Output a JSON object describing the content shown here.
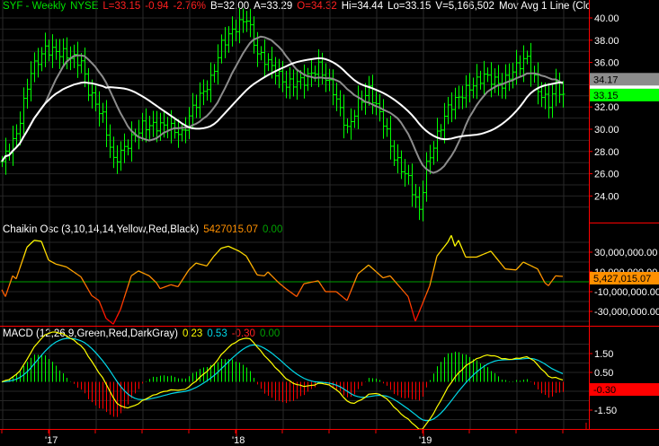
{
  "header": {
    "symbol": "SYF - Weekly",
    "exchange": "NYSE",
    "last": "L=33.15",
    "change": "-0.94",
    "change_pct": "-2.76%",
    "bid": "B=32.00",
    "ask": "A=33.29",
    "open": "O=34.32",
    "high": "Hi=34.44",
    "low": "Lo=33.15",
    "volume": "V=5,166,502",
    "study": "Mov Avg 1 Line (Close ..."
  },
  "chaikin_header": {
    "title": "Chaikin Osc (3,10,14,14,Yellow,Red,Black)",
    "value": "5427015.07",
    "zero": "0.00"
  },
  "macd_header": {
    "title": "MACD (12,26,9,Green,Red,DarkGray)",
    "macd": "0.23",
    "signal": "0.53",
    "hist": "-0.30",
    "zero": "0.00"
  },
  "colors": {
    "bars": "#00ff00",
    "fast_ma": "#8c8c8c",
    "slow_ma": "#ffffff",
    "macd": "#ffff00",
    "signal": "#00d8e8",
    "hist_pos": "#00ff00",
    "hist_neg": "#ff0000",
    "axis": "#ff0000"
  },
  "chart_data": [
    {
      "type": "line",
      "title": "SYF - Weekly price bars with moving averages",
      "x_unit": "week index",
      "xtick_labels": [
        {
          "week": 13,
          "label": "'17"
        },
        {
          "week": 65,
          "label": "'18"
        },
        {
          "week": 117,
          "label": "'19"
        }
      ],
      "ylim": [
        22,
        41
      ],
      "yticks": [
        "40.00",
        "38.00",
        "36.00",
        "34.00",
        "32.00",
        "30.00",
        "28.00",
        "26.00",
        "24.00"
      ],
      "close_keypoints": [
        [
          0,
          27.1
        ],
        [
          4,
          29.5
        ],
        [
          8,
          35.2
        ],
        [
          12,
          37.2
        ],
        [
          17,
          36.8
        ],
        [
          22,
          36.0
        ],
        [
          24,
          33.5
        ],
        [
          28,
          31.1
        ],
        [
          31,
          27.1
        ],
        [
          34,
          28.3
        ],
        [
          39,
          30.3
        ],
        [
          46,
          30.3
        ],
        [
          50,
          29.5
        ],
        [
          53,
          31.9
        ],
        [
          58,
          34.4
        ],
        [
          61,
          37.6
        ],
        [
          65,
          39.2
        ],
        [
          68,
          40.0
        ],
        [
          71,
          36.8
        ],
        [
          74,
          36.0
        ],
        [
          79,
          34.0
        ],
        [
          84,
          34.4
        ],
        [
          88,
          35.6
        ],
        [
          92,
          33.5
        ],
        [
          96,
          29.9
        ],
        [
          99,
          32.3
        ],
        [
          102,
          33.5
        ],
        [
          106,
          30.7
        ],
        [
          109,
          27.5
        ],
        [
          113,
          25.5
        ],
        [
          116,
          22.7
        ],
        [
          118,
          26.7
        ],
        [
          122,
          30.3
        ],
        [
          124,
          31.9
        ],
        [
          129,
          33.5
        ],
        [
          134,
          34.8
        ],
        [
          139,
          34.0
        ],
        [
          143,
          35.6
        ],
        [
          146,
          36.4
        ],
        [
          149,
          33.5
        ],
        [
          152,
          32.3
        ],
        [
          154,
          34.0
        ],
        [
          156,
          33.15
        ]
      ],
      "moving_averages": [
        {
          "name": "fast",
          "period": 13,
          "last": "34.17"
        },
        {
          "name": "slow",
          "period": 30
        }
      ],
      "last_price_label": "33.15"
    },
    {
      "type": "line",
      "title": "Chaikin Osc",
      "unit": "millions",
      "ylim": [
        -45,
        55
      ],
      "yticks": [
        "30,000,000.00",
        "10,000,000.00",
        "-10,000,000.00",
        "-30,000,000.00"
      ],
      "keypoints": [
        [
          0,
          -8
        ],
        [
          1,
          -15
        ],
        [
          3,
          6
        ],
        [
          4,
          3
        ],
        [
          7,
          35
        ],
        [
          9,
          42
        ],
        [
          11,
          41
        ],
        [
          13,
          22
        ],
        [
          15,
          18
        ],
        [
          18,
          15
        ],
        [
          22,
          5
        ],
        [
          25,
          -14
        ],
        [
          27,
          -19
        ],
        [
          29,
          -37
        ],
        [
          31,
          -43
        ],
        [
          33,
          -28
        ],
        [
          36,
          6
        ],
        [
          38,
          11
        ],
        [
          41,
          6
        ],
        [
          43,
          -1
        ],
        [
          44,
          -7
        ],
        [
          47,
          -3
        ],
        [
          49,
          -5
        ],
        [
          52,
          12
        ],
        [
          54,
          19
        ],
        [
          57,
          16
        ],
        [
          59,
          26
        ],
        [
          61,
          34
        ],
        [
          63,
          36
        ],
        [
          66,
          31
        ],
        [
          68,
          26
        ],
        [
          71,
          7
        ],
        [
          73,
          6
        ],
        [
          74,
          10
        ],
        [
          77,
          -1
        ],
        [
          79,
          -7
        ],
        [
          82,
          -15
        ],
        [
          84,
          -2
        ],
        [
          88,
          1
        ],
        [
          90,
          -10
        ],
        [
          93,
          -10
        ],
        [
          96,
          -19
        ],
        [
          99,
          8
        ],
        [
          102,
          17
        ],
        [
          106,
          4
        ],
        [
          108,
          6
        ],
        [
          113,
          -15
        ],
        [
          115,
          -40
        ],
        [
          119,
          -4
        ],
        [
          121,
          26
        ],
        [
          124,
          40
        ],
        [
          125,
          47
        ],
        [
          126,
          36
        ],
        [
          127,
          42
        ],
        [
          129,
          25
        ],
        [
          132,
          25
        ],
        [
          136,
          31
        ],
        [
          140,
          13
        ],
        [
          143,
          12
        ],
        [
          145,
          20
        ],
        [
          149,
          13
        ],
        [
          151,
          -1
        ],
        [
          152,
          -4
        ],
        [
          154,
          6
        ],
        [
          156,
          5.43
        ]
      ],
      "last_label": "5,427,015.07"
    },
    {
      "type": "line",
      "title": "MACD",
      "params": [
        12,
        26,
        9
      ],
      "yticks": [
        "1.50",
        "0.50",
        "-1.50"
      ],
      "last": {
        "macd": 0.23,
        "signal": 0.53,
        "hist": -0.3
      },
      "last_label": "-0.30"
    }
  ]
}
